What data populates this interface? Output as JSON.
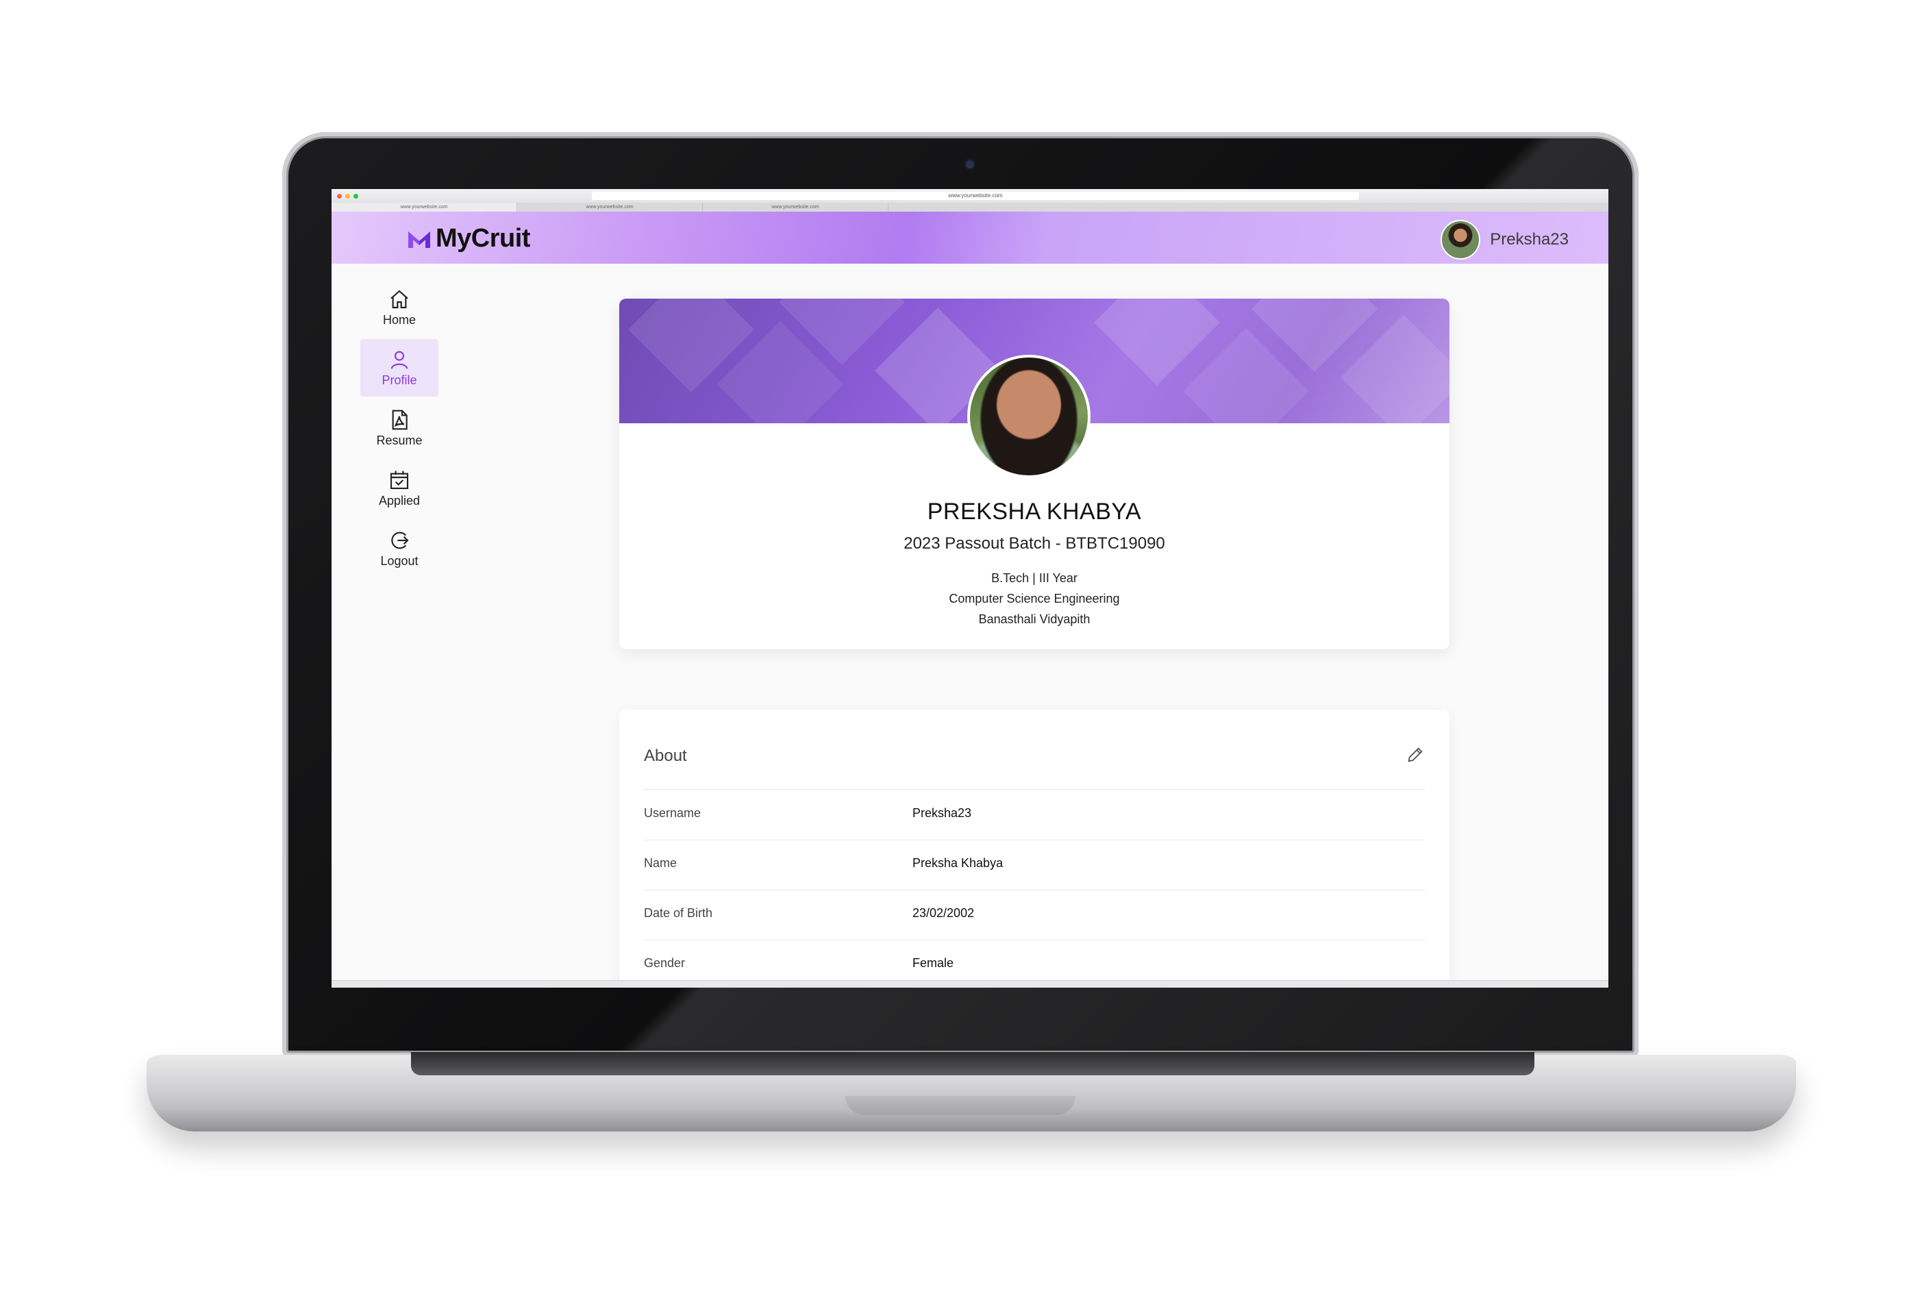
{
  "browser": {
    "url": "www.yourwebsite.com",
    "tabs": [
      "www.yourwebsite.com",
      "www.yourwebsite.com",
      "www.yourwebsite.com"
    ]
  },
  "header": {
    "brand": "MyCruit",
    "username": "Preksha23",
    "accent": "#b07cf0"
  },
  "sidebar": {
    "items": [
      {
        "label": "Home",
        "icon": "home-icon"
      },
      {
        "label": "Profile",
        "icon": "user-icon",
        "active": true
      },
      {
        "label": "Resume",
        "icon": "pdf-file-icon"
      },
      {
        "label": "Applied",
        "icon": "calendar-check-icon"
      },
      {
        "label": "Logout",
        "icon": "logout-icon"
      }
    ],
    "active_color": "#8b3bd9"
  },
  "profile": {
    "name": "PREKSHA KHABYA",
    "batch": "2023 Passout Batch - BTBTC19090",
    "course": "B.Tech | III Year",
    "branch": "Computer Science Engineering",
    "college": "Banasthali Vidyapith"
  },
  "about": {
    "title": "About",
    "fields": [
      {
        "label": "Username",
        "value": "Preksha23"
      },
      {
        "label": "Name",
        "value": "Preksha Khabya"
      },
      {
        "label": "Date of Birth",
        "value": "23/02/2002"
      },
      {
        "label": "Gender",
        "value": "Female"
      }
    ]
  }
}
